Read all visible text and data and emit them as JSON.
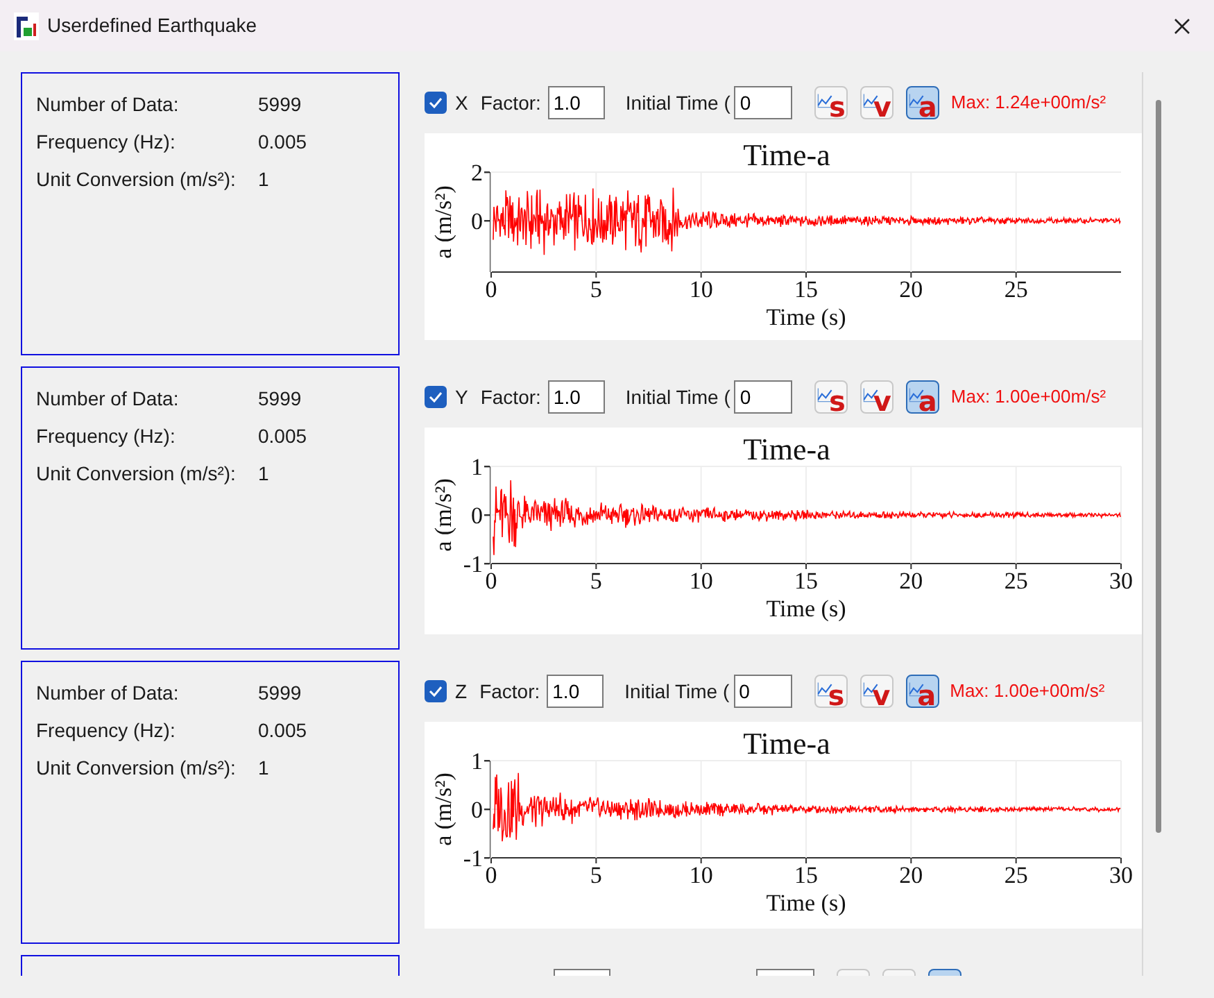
{
  "window": {
    "title": "Userdefined Earthquake"
  },
  "rows": [
    {
      "kind": "full",
      "info": [
        {
          "label": "Number of Data:",
          "value": "5999"
        },
        {
          "label": "Frequency (Hz):",
          "value": "0.005"
        },
        {
          "label": "Unit Conversion (m/s²):",
          "value": "1"
        }
      ],
      "axis": {
        "label": "X",
        "checked": true
      },
      "factor_label": "Factor:",
      "factor": "1.0",
      "initial_time_label": "Initial Time (",
      "initial_time": "0",
      "plot_buttons": [
        {
          "label": "s",
          "selected": false
        },
        {
          "label": "v",
          "selected": false
        },
        {
          "label": "a",
          "selected": true
        }
      ],
      "max": "Max: 1.24e+00m/s²",
      "chart": {
        "title": "Time-a",
        "xlabel": "Time (s)",
        "ylabel": "a (m/s²)",
        "xticks": [
          "0",
          "5",
          "10",
          "15",
          "20",
          "25"
        ],
        "yticks": [
          "2",
          "0"
        ]
      }
    },
    {
      "kind": "full",
      "info": [
        {
          "label": "Number of Data:",
          "value": "5999"
        },
        {
          "label": "Frequency (Hz):",
          "value": "0.005"
        },
        {
          "label": "Unit Conversion (m/s²):",
          "value": "1"
        }
      ],
      "axis": {
        "label": "Y",
        "checked": true
      },
      "factor_label": "Factor:",
      "factor": "1.0",
      "initial_time_label": "Initial Time (",
      "initial_time": "0",
      "plot_buttons": [
        {
          "label": "s",
          "selected": false
        },
        {
          "label": "v",
          "selected": false
        },
        {
          "label": "a",
          "selected": true
        }
      ],
      "max": "Max: 1.00e+00m/s²",
      "chart": {
        "title": "Time-a",
        "xlabel": "Time (s)",
        "ylabel": "a (m/s²)",
        "xticks": [
          "0",
          "5",
          "10",
          "15",
          "20",
          "25",
          "30"
        ],
        "yticks": [
          "1",
          "0",
          "-1"
        ]
      }
    },
    {
      "kind": "full",
      "info": [
        {
          "label": "Number of Data:",
          "value": "5999"
        },
        {
          "label": "Frequency (Hz):",
          "value": "0.005"
        },
        {
          "label": "Unit Conversion (m/s²):",
          "value": "1"
        }
      ],
      "axis": {
        "label": "Z",
        "checked": true
      },
      "factor_label": "Factor:",
      "factor": "1.0",
      "initial_time_label": "Initial Time (",
      "initial_time": "0",
      "plot_buttons": [
        {
          "label": "s",
          "selected": false
        },
        {
          "label": "v",
          "selected": false
        },
        {
          "label": "a",
          "selected": true
        }
      ],
      "max": "Max: 1.00e+00m/s²",
      "chart": {
        "title": "Time-a",
        "xlabel": "Time (s)",
        "ylabel": "a (m/s²)",
        "xticks": [
          "0",
          "5",
          "10",
          "15",
          "20",
          "25",
          "30"
        ],
        "yticks": [
          "1",
          "0",
          "-1"
        ]
      }
    },
    {
      "kind": "cut",
      "plot_buttons": [
        {
          "selected": false
        },
        {
          "selected": false
        },
        {
          "selected": true
        }
      ]
    }
  ]
}
